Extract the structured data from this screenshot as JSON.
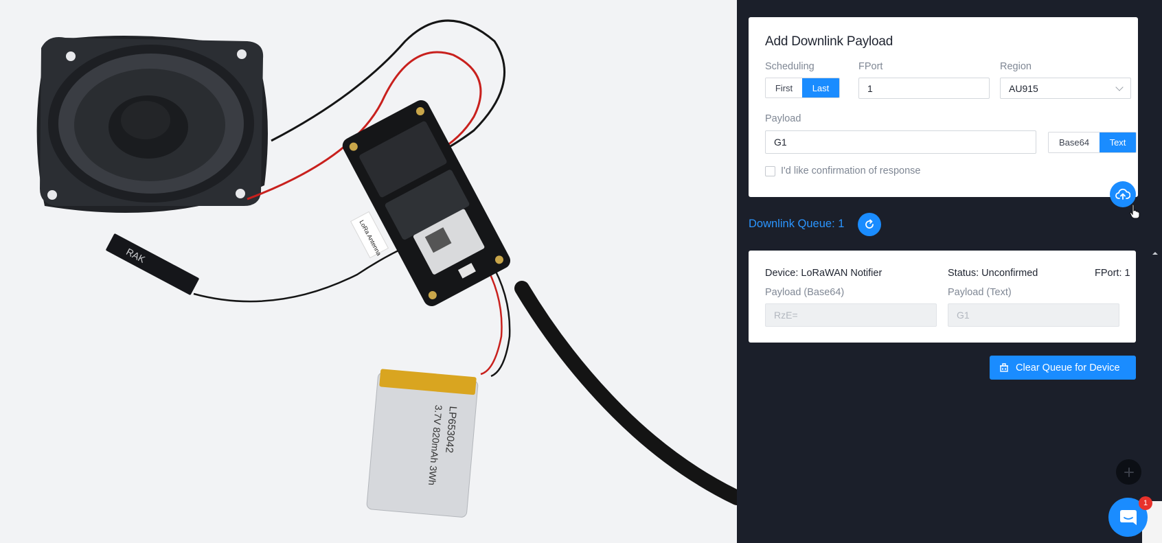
{
  "photo": {
    "antenna_label": "LoRa Antenna",
    "antenna_brand": "RAK",
    "battery_model": "LP653042",
    "battery_spec": "3.7V 820mAh 3Wh"
  },
  "add_payload": {
    "title": "Add Downlink Payload",
    "scheduling_label": "Scheduling",
    "scheduling_options": [
      "First",
      "Last"
    ],
    "scheduling_selected": "Last",
    "fport_label": "FPort",
    "fport_value": "1",
    "region_label": "Region",
    "region_value": "AU915",
    "payload_label": "Payload",
    "payload_value": "G1",
    "format_options": [
      "Base64",
      "Text"
    ],
    "format_selected": "Text",
    "confirm_label": "I'd like confirmation of response",
    "confirm_checked": false
  },
  "queue": {
    "title": "Downlink Queue: 1",
    "item": {
      "device": "Device: LoRaWAN Notifier",
      "status": "Status: Unconfirmed",
      "fport": "FPort: 1",
      "payload_base64_label": "Payload (Base64)",
      "payload_base64_value": "RzE=",
      "payload_text_label": "Payload (Text)",
      "payload_text_value": "G1"
    },
    "clear_label": "Clear Queue for Device"
  },
  "chat": {
    "badge_count": "1"
  },
  "colors": {
    "accent": "#1a8cff",
    "panel_bg": "#1b1f2a",
    "badge": "#e8322b"
  },
  "icons": [
    "cloud-upload-icon",
    "refresh-icon",
    "clear-icon",
    "plus-icon",
    "chat-icon",
    "cursor-icon"
  ]
}
